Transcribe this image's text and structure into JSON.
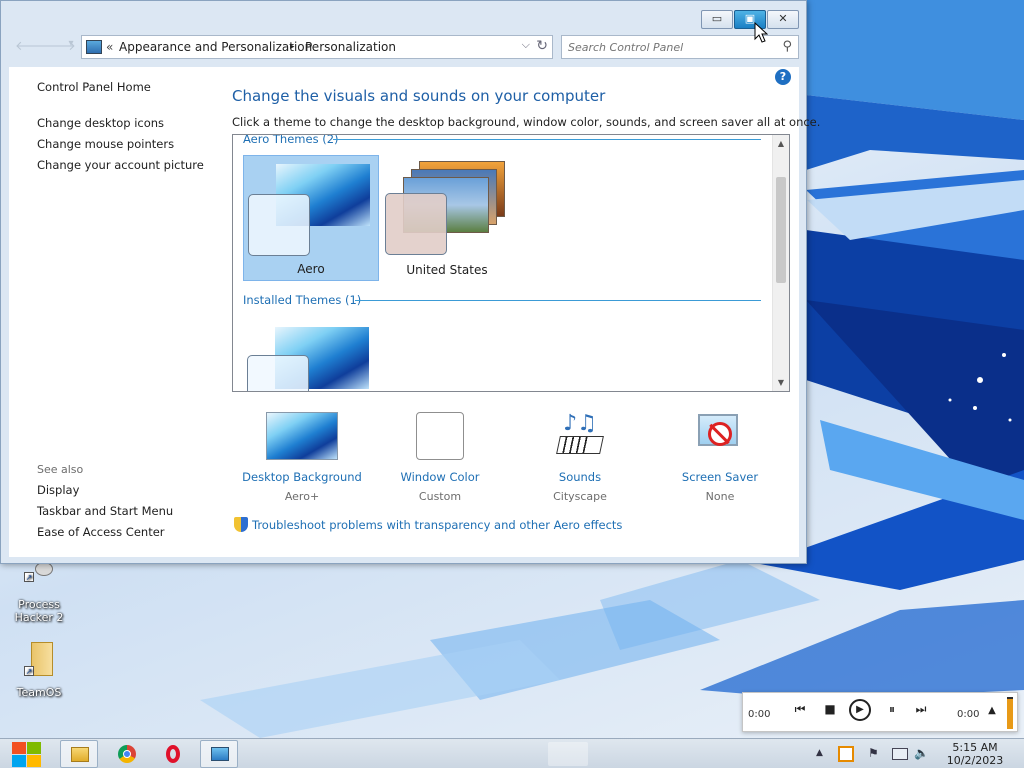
{
  "window": {
    "buttons": {
      "minimize": "▭",
      "maximize": "▣",
      "close": "✕"
    },
    "nav": {
      "back": "🡐",
      "forward": "🡒",
      "recent": "▾"
    },
    "address": {
      "prefix": "«",
      "crumb1": "Appearance and Personalization",
      "separator": "▸",
      "crumb2": "Personalization",
      "dropdown": "⌵",
      "refresh": "↻"
    },
    "search": {
      "placeholder": "Search Control Panel",
      "icon": "⚲"
    },
    "help": "?"
  },
  "sidebar": {
    "home": "Control Panel Home",
    "links": [
      "Change desktop icons",
      "Change mouse pointers",
      "Change your account picture"
    ],
    "see_also_label": "See also",
    "see_also": [
      "Display",
      "Taskbar and Start Menu",
      "Ease of Access Center"
    ]
  },
  "main": {
    "title": "Change the visuals and sounds on your computer",
    "description": "Click a theme to change the desktop background, window color, sounds, and screen saver all at once.",
    "groups": [
      {
        "header": "Aero Themes (2)",
        "themes": [
          "Aero",
          "United States"
        ]
      },
      {
        "header": "Installed Themes (1)",
        "themes": [
          ""
        ]
      }
    ],
    "selected_theme": "Aero",
    "settings": [
      {
        "label": "Desktop Background",
        "value": "Aero+",
        "icon": "wallpaper-icon"
      },
      {
        "label": "Window Color",
        "value": "Custom",
        "icon": "color-swatch-icon"
      },
      {
        "label": "Sounds",
        "value": "Cityscape",
        "icon": "music-notes-icon"
      },
      {
        "label": "Screen Saver",
        "value": "None",
        "icon": "screensaver-icon"
      }
    ],
    "troubleshoot": "Troubleshoot problems with transparency and other Aero effects"
  },
  "desktop_icons": [
    {
      "label": "Process Hacker 2"
    },
    {
      "label": "TeamOS"
    }
  ],
  "media_player": {
    "time_elapsed": "0:00",
    "time_total": "0:00",
    "controls": {
      "prev": "⏮",
      "stop": "■",
      "play": "▶",
      "pause": "⏸",
      "next": "⏭",
      "expand": "▲"
    }
  },
  "taskbar": {
    "pinned": [
      "file-explorer-icon",
      "chrome-icon",
      "opera-icon",
      "control-panel-icon"
    ],
    "tray": {
      "chevron": "▲",
      "flag": "⚑",
      "speaker": "🔈"
    },
    "clock": {
      "time": "5:15 AM",
      "date": "10/2/2023"
    }
  },
  "colors": {
    "link": "#1e6fb4",
    "title": "#1e5fa6",
    "selection": "#a9d1f2",
    "accent": "#1b7fc4"
  }
}
